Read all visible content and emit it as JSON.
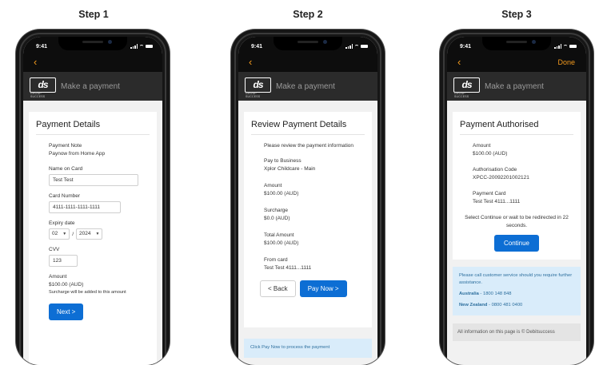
{
  "steps": {
    "step1": "Step 1",
    "step2": "Step 2",
    "step3": "Step 3"
  },
  "status": {
    "time": "9:41"
  },
  "nav": {
    "back_label": "‹",
    "done_label": "Done"
  },
  "header": {
    "logo_text": "ds",
    "logo_sub": "GROUP SUCCESS",
    "title": "Make a payment"
  },
  "screen1": {
    "title": "Payment Details",
    "note_label": "Payment Note",
    "note_value": "Paynow from Home App",
    "name_label": "Name on Card",
    "name_value": "Test Test",
    "card_label": "Card Number",
    "card_value": "4111-1111-1111-1111",
    "expiry_label": "Expiry date",
    "expiry_month": "02",
    "expiry_sep": "/",
    "expiry_year": "2024",
    "cvv_label": "CVV",
    "cvv_value": "123",
    "amount_label": "Amount",
    "amount_value": "$100.00 (AUD)",
    "surcharge_note": "Surcharge will be added to this amount",
    "next_button": "Next >"
  },
  "screen2": {
    "title": "Review Payment Details",
    "intro": "Please review the payment information",
    "business_label": "Pay to Business",
    "business_value": "Xplor Childcare - Main",
    "amount_label": "Amount",
    "amount_value": "$100.00 (AUD)",
    "surcharge_label": "Surcharge",
    "surcharge_value": "$0.0 (AUD)",
    "total_label": "Total Amount",
    "total_value": "$100.00 (AUD)",
    "card_label": "From card",
    "card_value": "Test Test 4111...1111",
    "back_button": "< Back",
    "pay_button": "Pay Now >",
    "hint": "Click Pay Now to process the payment"
  },
  "screen3": {
    "title": "Payment Authorised",
    "amount_label": "Amount",
    "amount_value": "$100.00  (AUD)",
    "auth_label": "Authorisation Code",
    "auth_value": "XPCC-20092201002121",
    "card_label": "Payment Card",
    "card_value": "Test Test   4111...1111",
    "redirect_text": "Select Continue or wait to be redirected in 22 seconds.",
    "continue_button": "Continue",
    "support_text": "Please call customer service should you require further assistance.",
    "au_label": "Australia",
    "au_phone": " - 1800 148 848",
    "nz_label": "New Zealand",
    "nz_phone": " - 0800 481 0400",
    "footer": "All information on this page is © Debitsuccess"
  }
}
